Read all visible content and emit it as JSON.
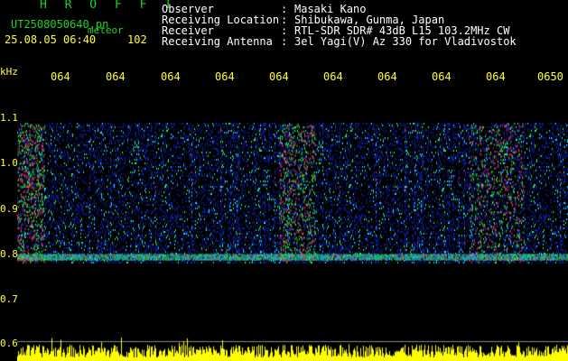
{
  "header": {
    "title": "H R O F F T",
    "filename": "UT2508050640.pn",
    "filename_suffix": "meteor",
    "datetime": "25.08.05 06:40",
    "count": "102",
    "fields": [
      {
        "label": "Observer",
        "sep": ":",
        "value": "Masaki Kano"
      },
      {
        "label": "Receiving Location",
        "sep": ":",
        "value": "Shibukawa, Gunma, Japan"
      },
      {
        "label": "Receiver",
        "sep": ":",
        "value": "RTL-SDR SDR# 43dB L15 103.2MHz CW"
      },
      {
        "label": "Receiving Antenna",
        "sep": ":",
        "value": "3el Yagi(V) Az 330 for Vladivostok"
      }
    ]
  },
  "chart_data": {
    "type": "heatmap",
    "ylabel": "kHz",
    "y_ticks": [
      "1.1",
      "1.0",
      "0.9",
      "0.8",
      "0.7",
      "0.6"
    ],
    "x_ticks": [
      "064",
      "064",
      "064",
      "064",
      "064",
      "064",
      "064",
      "064",
      "064",
      "0650"
    ],
    "ylim": [
      0.58,
      1.14
    ],
    "echo_band_khz": 0.79,
    "colors": {
      "background": "#000000",
      "low": "#0a1f9e",
      "mid": "#1fd4ff",
      "high": "#2bff3a",
      "peak": "#ff2a6a",
      "amplitude_bar": "#ffff00",
      "text_yellow": "#ffff33",
      "title_green": "#1fd41f"
    }
  }
}
